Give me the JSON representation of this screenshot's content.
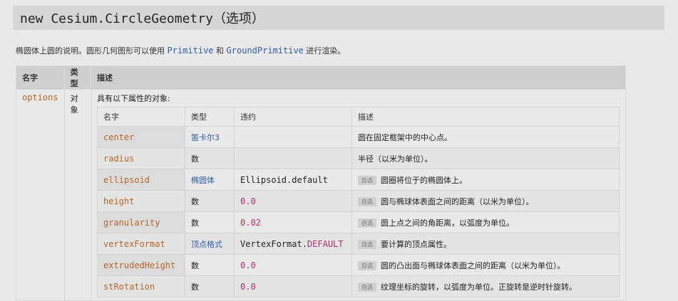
{
  "title": {
    "main": "new Cesium.CircleGeometry",
    "options": "（选项）"
  },
  "description": {
    "before": "椭圆体上圆的说明。圆形几何图形可以使用 ",
    "link1": "Primitive",
    "middle": " 和 ",
    "link2": "GroundPrimitive",
    "after": " 进行渲染。"
  },
  "outer_table": {
    "headers": [
      "名字",
      "类型",
      "描述"
    ],
    "param_name": "options",
    "param_type": "对象",
    "param_desc": "具有以下属性的对象:"
  },
  "inner_table": {
    "headers": [
      "名字",
      "类型",
      "违约",
      "描述"
    ],
    "optional_badge": "自选",
    "rows": [
      {
        "name": "center",
        "type": "笛卡尔3",
        "default": "",
        "default_num": "",
        "default_kw": "",
        "desc": "圆在固定框架中的中心点。",
        "optional": false
      },
      {
        "name": "radius",
        "type": "数",
        "default": "",
        "default_num": "",
        "default_kw": "",
        "desc": "半径（以米为单位）。",
        "optional": false
      },
      {
        "name": "ellipsoid",
        "type": "椭圆体",
        "default": "Ellipsoid.default",
        "default_num": "",
        "default_kw": "",
        "desc": "圆圈将位于的椭圆体上。",
        "optional": true
      },
      {
        "name": "height",
        "type": "数",
        "default": "",
        "default_num": "0.0",
        "default_kw": "",
        "desc": "圆与椭球体表面之间的距离（以米为单位）。",
        "optional": true
      },
      {
        "name": "granularity",
        "type": "数",
        "default": "",
        "default_num": "0.02",
        "default_kw": "",
        "desc": "圆上点之间的角距离，以弧度为单位。",
        "optional": true
      },
      {
        "name": "vertexFormat",
        "type": "顶点格式",
        "default": "VertexFormat.",
        "default_num": "",
        "default_kw": "DEFAULT",
        "desc": "要计算的顶点属性。",
        "optional": true
      },
      {
        "name": "extrudedHeight",
        "type": "数",
        "default": "",
        "default_num": "0.0",
        "default_kw": "",
        "desc": "圆的凸出面与椭球体表面之间的距离（以米为单位）。",
        "optional": true
      },
      {
        "name": "stRotation",
        "type": "数",
        "default": "",
        "default_num": "0.0",
        "default_kw": "",
        "desc": "纹理坐标的旋转，以弧度为单位。正旋转是逆时针旋转。",
        "optional": true
      }
    ]
  }
}
